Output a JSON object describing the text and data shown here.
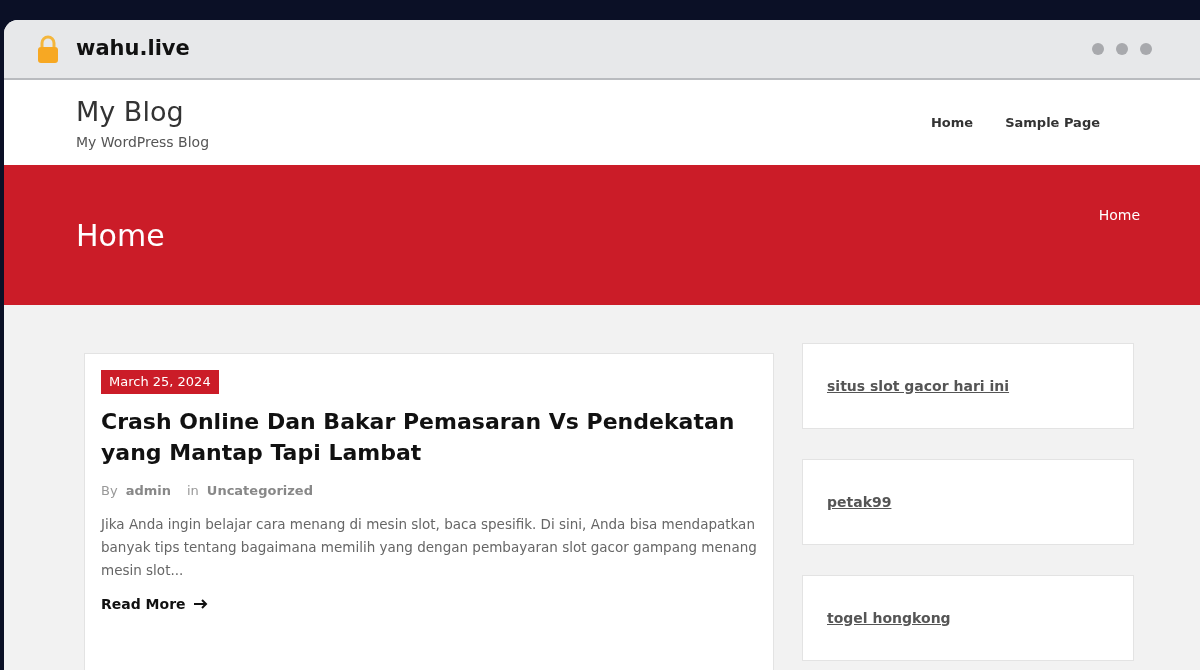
{
  "address_bar": {
    "url": "wahu.live"
  },
  "site": {
    "title": "My Blog",
    "tagline": "My WordPress Blog"
  },
  "nav": [
    {
      "label": "Home"
    },
    {
      "label": "Sample Page"
    }
  ],
  "banner": {
    "title": "Home",
    "breadcrumb": "Home"
  },
  "post": {
    "date": "March 25, 2024",
    "title": "Crash Online Dan Bakar Pemasaran Vs Pendekatan yang Mantap Tapi Lambat",
    "by": "By",
    "author": "admin",
    "in": "in",
    "category": "Uncategorized",
    "excerpt": "Jika Anda ingin belajar cara menang di mesin slot, baca spesifik. Di sini, Anda bisa mendapatkan banyak tips tentang bagaimana memilih yang dengan pembayaran slot gacor gampang menang mesin slot...",
    "read_more": "Read More"
  },
  "sidebar": [
    {
      "link": "situs slot gacor hari ini"
    },
    {
      "link": "petak99"
    },
    {
      "link": "togel hongkong"
    }
  ]
}
